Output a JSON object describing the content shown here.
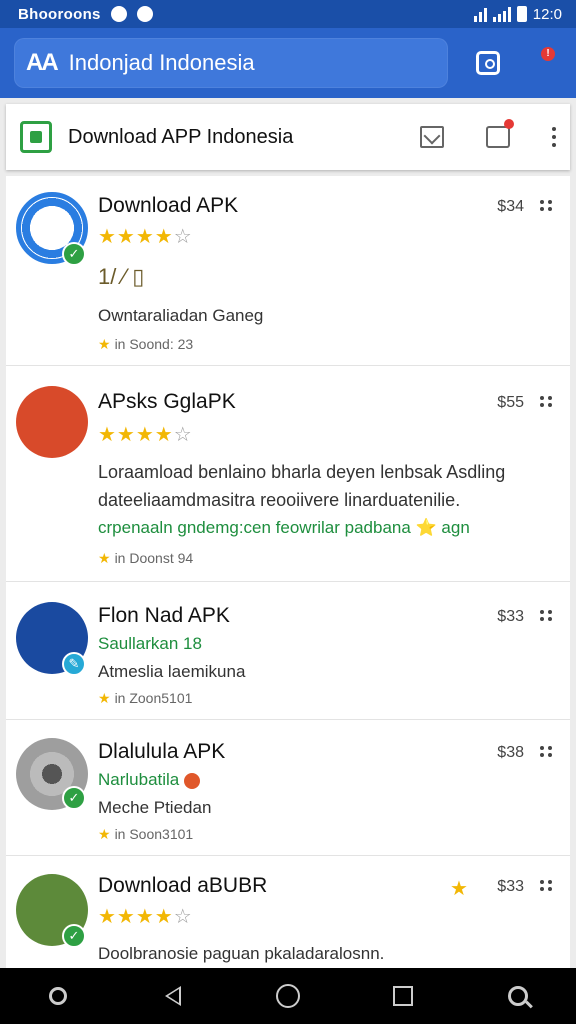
{
  "status_bar": {
    "carrier": "Bhooroons",
    "time": "12:0"
  },
  "app_bar": {
    "logo": "AA",
    "title": "Indonjad Indonesia",
    "icons": [
      "app-frame-icon",
      "alert-icon"
    ]
  },
  "header_card": {
    "title": "Download APP Indonesia",
    "icons": [
      "app-logo-icon",
      "mail-icon",
      "chat-icon",
      "more-vert-icon"
    ]
  },
  "items": [
    {
      "name": "Download APK",
      "price": "$34",
      "stars": "★★★★",
      "stars_off": "☆",
      "line1": "1/ ⁄ ▯",
      "line2": "Owntaraliadan Ganeg",
      "meta": "in Soond: 23",
      "avatar_color": "#2a7de1",
      "badge_color": "#2ea043"
    },
    {
      "name": "APsks GglaPK",
      "price": "$55",
      "stars": "★★★★",
      "stars_off": "☆",
      "line1": "Loraamload benlaino bharla deyen lenbsak Asdling",
      "line2": "dateeliaamdmasitra reooiivere linarduatenilie.",
      "line3": "crpenaaln gndemg:cen feowrilar padbana ⭐ agn",
      "meta": "in Doonst 94",
      "avatar_color": "#d84a2a",
      "badge_color": "#2ea043"
    },
    {
      "name": "Flon Nad APK",
      "price": "$33",
      "line1": "Saullarkan 18",
      "line2": "Atmeslia laemikuna",
      "meta": "in Zoon5101",
      "avatar_color": "#1a4aa0",
      "badge_color": "#26a9d6"
    },
    {
      "name": "Dlalulula APK",
      "price": "$38",
      "line1": "Narlubatila",
      "line2": "Meche Ptiedan",
      "meta": "in Soon3101",
      "avatar_color": "#9e9e9e",
      "badge_color": "#2ea043"
    },
    {
      "name": "Download aBUBR",
      "price": "$33",
      "stars": "★★★★",
      "stars_off": "☆",
      "line1": "Doolbranosie paguan pkaladaralosnn.",
      "avatar_color": "#5d8a3a",
      "badge_color": "#2ea043"
    }
  ],
  "nav_bar": {
    "icons": [
      "record-icon",
      "back-icon",
      "home-icon",
      "recents-icon",
      "search-icon"
    ]
  }
}
